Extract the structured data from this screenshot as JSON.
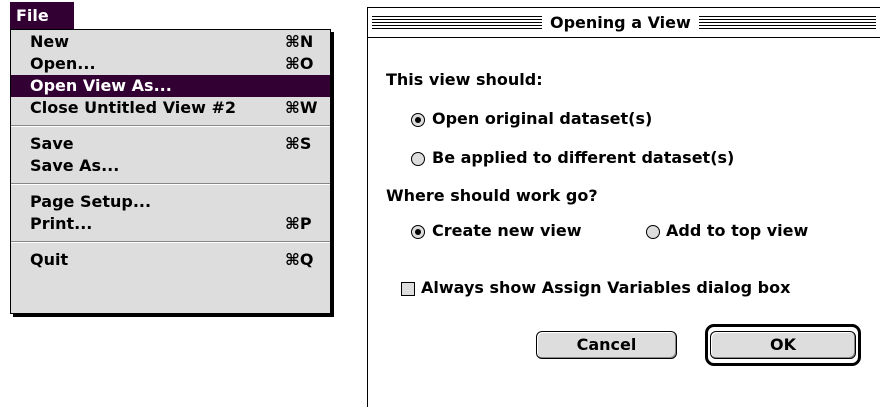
{
  "menu": {
    "title": "File",
    "items": [
      {
        "label": "New",
        "shortcut": "⌘N"
      },
      {
        "label": "Open...",
        "shortcut": "⌘O"
      },
      {
        "label": "Open View As...",
        "shortcut": ""
      },
      {
        "label": "Close Untitled View #2",
        "shortcut": "⌘W"
      },
      {
        "label": "Save",
        "shortcut": "⌘S"
      },
      {
        "label": "Save As...",
        "shortcut": ""
      },
      {
        "label": "Page Setup...",
        "shortcut": ""
      },
      {
        "label": "Print...",
        "shortcut": "⌘P"
      },
      {
        "label": "Quit",
        "shortcut": "⌘Q"
      }
    ],
    "highlighted_item": "Open View As..."
  },
  "dialog": {
    "title": "Opening a View",
    "question1": "This view should:",
    "radio_open_original": "Open original dataset(s)",
    "radio_apply_different": "Be applied to different dataset(s)",
    "question2": "Where should work go?",
    "radio_create_new": "Create new view",
    "radio_add_top": "Add to top view",
    "checkbox_always_show": "Always show Assign Variables dialog box",
    "cancel_label": "Cancel",
    "ok_label": "OK",
    "selected": {
      "dataset_choice": "Open original dataset(s)",
      "work_choice": "Create new view",
      "always_show_checked": false
    }
  },
  "colors": {
    "highlight": "#330033",
    "menu_bg": "#dddddd"
  }
}
